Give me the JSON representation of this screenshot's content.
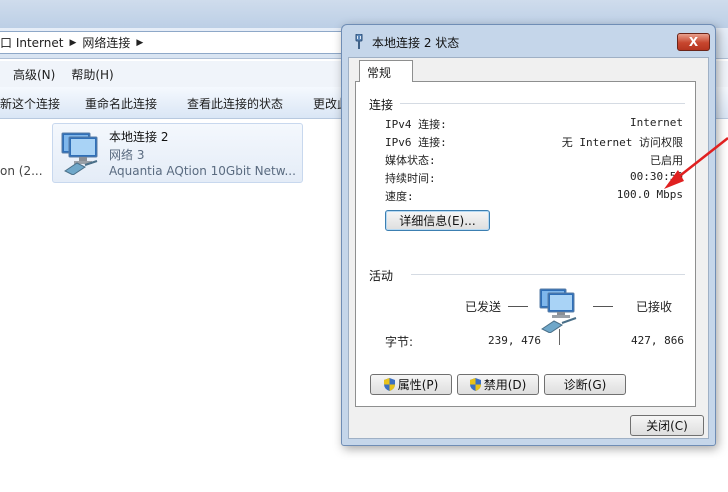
{
  "explorer": {
    "breadcrumb": [
      "口 Internet",
      "网络连接"
    ],
    "menu": [
      "高级(N)",
      "帮助(H)"
    ],
    "commands": [
      "新这个连接",
      "重命名此连接",
      "查看此连接的状态",
      "更改此"
    ],
    "left_fragment": "on (2...",
    "tile": {
      "name": "本地连接 2",
      "network": "网络  3",
      "adapter": "Aquantia AQtion 10Gbit Netw..."
    }
  },
  "dialog": {
    "title": "本地连接 2 状态",
    "close_label": "X",
    "tab": "常规",
    "connection": {
      "heading": "连接",
      "rows": [
        {
          "label": "IPv4 连接:",
          "value": "Internet"
        },
        {
          "label": "IPv6 连接:",
          "value": "无 Internet 访问权限"
        },
        {
          "label": "媒体状态:",
          "value": "已启用"
        },
        {
          "label": "持续时间:",
          "value": "00:30:50"
        },
        {
          "label": "速度:",
          "value": "100.0 Mbps"
        }
      ],
      "details_button": "详细信息(E)..."
    },
    "activity": {
      "heading": "活动",
      "sent_label": "已发送",
      "received_label": "已接收",
      "bytes_label": "字节:",
      "bytes_sent": "239, 476",
      "bytes_received": "427, 866"
    },
    "buttons": {
      "properties": "属性(P)",
      "disable": "禁用(D)",
      "diagnose": "诊断(G)",
      "close": "关闭(C)"
    }
  },
  "colors": {
    "annotation_arrow": "#e02020",
    "close_button": "#c7462e",
    "dialog_frame": "#c5d6ea"
  }
}
